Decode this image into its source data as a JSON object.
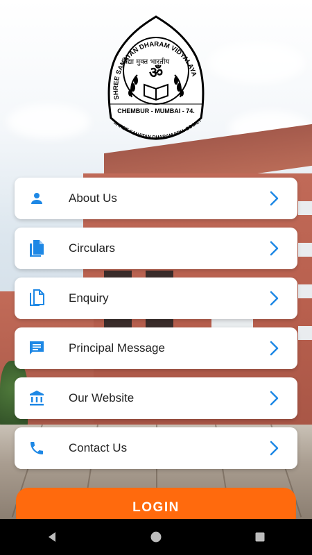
{
  "logo": {
    "arc_text": "SHREE SANATAN DHARAM VIDYALAYA",
    "devanagari_text": "विद्या मुक्त भारतीय",
    "location_text": "CHEMBUR - MUMBAI - 74.",
    "bottom_arc_text": "SHREE SANATAN DHARAM EDU. SOCIETY",
    "emblem_symbol": "ॐ"
  },
  "menu": {
    "items": [
      {
        "label": "About Us",
        "icon": "person-icon"
      },
      {
        "label": "Circulars",
        "icon": "document-icon"
      },
      {
        "label": "Enquiry",
        "icon": "copy-icon"
      },
      {
        "label": "Principal Message",
        "icon": "message-icon"
      },
      {
        "label": "Our Website",
        "icon": "bank-icon"
      },
      {
        "label": "Contact Us",
        "icon": "phone-icon"
      }
    ]
  },
  "login": {
    "label": "LOGIN"
  },
  "colors": {
    "accent_blue": "#1e88e5",
    "login_orange": "#ff6a0d",
    "card_bg": "#ffffff",
    "navbar_bg": "#000000"
  }
}
